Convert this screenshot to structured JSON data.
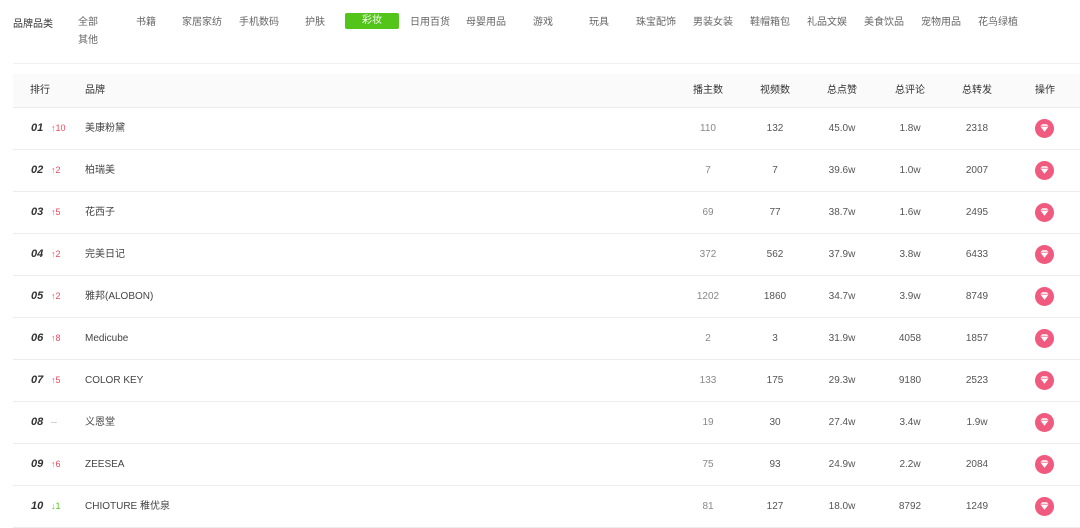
{
  "filter": {
    "label": "品牌品类",
    "categories": [
      "全部",
      "书籍",
      "家居家纺",
      "手机数码",
      "护肤",
      "彩妆",
      "日用百货",
      "母婴用品",
      "游戏",
      "玩具",
      "珠宝配饰",
      "男装女装",
      "鞋帽箱包",
      "礼品文娱",
      "美食饮品",
      "宠物用品",
      "花鸟绿植",
      "其他"
    ],
    "active": "彩妆"
  },
  "table": {
    "headers": {
      "rank": "排行",
      "brand": "品牌",
      "anchors": "播主数",
      "videos": "视频数",
      "likes": "总点赞",
      "comments": "总评论",
      "shares": "总转发",
      "action": "操作"
    },
    "rows": [
      {
        "rank": "01",
        "change": "↑10",
        "trend": "up",
        "brand": "美康粉黛",
        "anchors": "110",
        "videos": "132",
        "likes": "45.0w",
        "comments": "1.8w",
        "shares": "2318"
      },
      {
        "rank": "02",
        "change": "↑2",
        "trend": "up",
        "brand": "柏瑞美",
        "anchors": "7",
        "videos": "7",
        "likes": "39.6w",
        "comments": "1.0w",
        "shares": "2007"
      },
      {
        "rank": "03",
        "change": "↑5",
        "trend": "up",
        "brand": "花西子",
        "anchors": "69",
        "videos": "77",
        "likes": "38.7w",
        "comments": "1.6w",
        "shares": "2495"
      },
      {
        "rank": "04",
        "change": "↑2",
        "trend": "up",
        "brand": "完美日记",
        "anchors": "372",
        "videos": "562",
        "likes": "37.9w",
        "comments": "3.8w",
        "shares": "6433"
      },
      {
        "rank": "05",
        "change": "↑2",
        "trend": "up",
        "brand": "雅邦(ALOBON)",
        "anchors": "1202",
        "videos": "1860",
        "likes": "34.7w",
        "comments": "3.9w",
        "shares": "8749"
      },
      {
        "rank": "06",
        "change": "↑8",
        "trend": "up",
        "brand": "Medicube",
        "anchors": "2",
        "videos": "3",
        "likes": "31.9w",
        "comments": "4058",
        "shares": "1857"
      },
      {
        "rank": "07",
        "change": "↑5",
        "trend": "up",
        "brand": "COLOR KEY",
        "anchors": "133",
        "videos": "175",
        "likes": "29.3w",
        "comments": "9180",
        "shares": "2523"
      },
      {
        "rank": "08",
        "change": "--",
        "trend": "same",
        "brand": "义恩堂",
        "anchors": "19",
        "videos": "30",
        "likes": "27.4w",
        "comments": "3.4w",
        "shares": "1.9w"
      },
      {
        "rank": "09",
        "change": "↑6",
        "trend": "up",
        "brand": "ZEESEA",
        "anchors": "75",
        "videos": "93",
        "likes": "24.9w",
        "comments": "2.2w",
        "shares": "2084"
      },
      {
        "rank": "10",
        "change": "↓1",
        "trend": "down",
        "brand": "CHIOTURE 稚优泉",
        "anchors": "81",
        "videos": "127",
        "likes": "18.0w",
        "comments": "8792",
        "shares": "1249"
      }
    ],
    "action_icon": "heart-diamond-icon"
  },
  "colors": {
    "accent": "#52c41a",
    "up": "#e84a5f",
    "down": "#52c41a",
    "action": "#f05a7e"
  }
}
